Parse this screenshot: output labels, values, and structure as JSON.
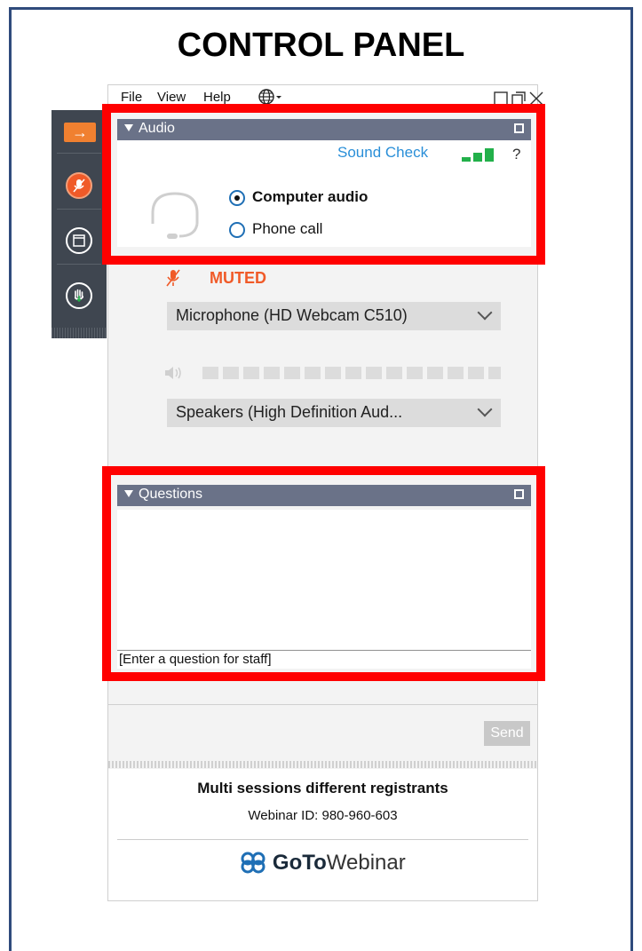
{
  "page_title": "CONTROL PANEL",
  "menu": {
    "file": "File",
    "view": "View",
    "help": "Help"
  },
  "audio": {
    "header": "Audio",
    "sound_check": "Sound Check",
    "help_mark": "?",
    "computer_audio": "Computer audio",
    "phone_call": "Phone call",
    "selected_option": "Computer audio",
    "muted_label": "MUTED",
    "microphone": "Microphone (HD Webcam C510)",
    "speakers": "Speakers (High Definition Aud..."
  },
  "questions": {
    "header": "Questions",
    "placeholder": "[Enter a question for staff]",
    "send": "Send"
  },
  "footer": {
    "session_title": "Multi sessions different registrants",
    "webinar_id": "Webinar ID: 980-960-603",
    "brand_bold": "GoTo",
    "brand_light": "Webinar"
  },
  "colors": {
    "frame": "#2f4b7c",
    "section_bar": "#6a7288",
    "highlight": "#ff0000",
    "muted": "#f05a28",
    "link": "#2a8fd8",
    "signal": "#22b04a"
  },
  "icons": [
    "arrow-icon",
    "mic-muted-icon",
    "window-icon",
    "raise-hand-icon",
    "headset-icon",
    "speaker-icon",
    "globe-icon",
    "gotowebinar-logo-icon"
  ]
}
